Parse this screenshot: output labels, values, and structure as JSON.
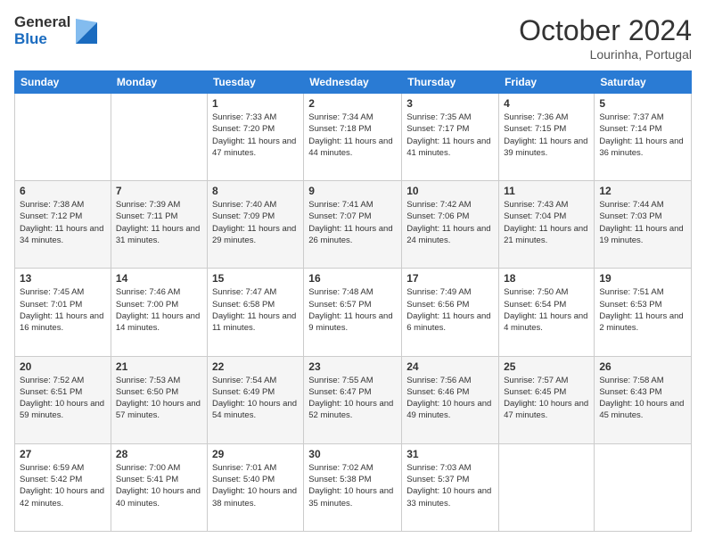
{
  "logo": {
    "general": "General",
    "blue": "Blue"
  },
  "header": {
    "month": "October 2024",
    "location": "Lourinha, Portugal"
  },
  "weekdays": [
    "Sunday",
    "Monday",
    "Tuesday",
    "Wednesday",
    "Thursday",
    "Friday",
    "Saturday"
  ],
  "weeks": [
    [
      {
        "day": "",
        "info": ""
      },
      {
        "day": "",
        "info": ""
      },
      {
        "day": "1",
        "info": "Sunrise: 7:33 AM\nSunset: 7:20 PM\nDaylight: 11 hours and 47 minutes."
      },
      {
        "day": "2",
        "info": "Sunrise: 7:34 AM\nSunset: 7:18 PM\nDaylight: 11 hours and 44 minutes."
      },
      {
        "day": "3",
        "info": "Sunrise: 7:35 AM\nSunset: 7:17 PM\nDaylight: 11 hours and 41 minutes."
      },
      {
        "day": "4",
        "info": "Sunrise: 7:36 AM\nSunset: 7:15 PM\nDaylight: 11 hours and 39 minutes."
      },
      {
        "day": "5",
        "info": "Sunrise: 7:37 AM\nSunset: 7:14 PM\nDaylight: 11 hours and 36 minutes."
      }
    ],
    [
      {
        "day": "6",
        "info": "Sunrise: 7:38 AM\nSunset: 7:12 PM\nDaylight: 11 hours and 34 minutes."
      },
      {
        "day": "7",
        "info": "Sunrise: 7:39 AM\nSunset: 7:11 PM\nDaylight: 11 hours and 31 minutes."
      },
      {
        "day": "8",
        "info": "Sunrise: 7:40 AM\nSunset: 7:09 PM\nDaylight: 11 hours and 29 minutes."
      },
      {
        "day": "9",
        "info": "Sunrise: 7:41 AM\nSunset: 7:07 PM\nDaylight: 11 hours and 26 minutes."
      },
      {
        "day": "10",
        "info": "Sunrise: 7:42 AM\nSunset: 7:06 PM\nDaylight: 11 hours and 24 minutes."
      },
      {
        "day": "11",
        "info": "Sunrise: 7:43 AM\nSunset: 7:04 PM\nDaylight: 11 hours and 21 minutes."
      },
      {
        "day": "12",
        "info": "Sunrise: 7:44 AM\nSunset: 7:03 PM\nDaylight: 11 hours and 19 minutes."
      }
    ],
    [
      {
        "day": "13",
        "info": "Sunrise: 7:45 AM\nSunset: 7:01 PM\nDaylight: 11 hours and 16 minutes."
      },
      {
        "day": "14",
        "info": "Sunrise: 7:46 AM\nSunset: 7:00 PM\nDaylight: 11 hours and 14 minutes."
      },
      {
        "day": "15",
        "info": "Sunrise: 7:47 AM\nSunset: 6:58 PM\nDaylight: 11 hours and 11 minutes."
      },
      {
        "day": "16",
        "info": "Sunrise: 7:48 AM\nSunset: 6:57 PM\nDaylight: 11 hours and 9 minutes."
      },
      {
        "day": "17",
        "info": "Sunrise: 7:49 AM\nSunset: 6:56 PM\nDaylight: 11 hours and 6 minutes."
      },
      {
        "day": "18",
        "info": "Sunrise: 7:50 AM\nSunset: 6:54 PM\nDaylight: 11 hours and 4 minutes."
      },
      {
        "day": "19",
        "info": "Sunrise: 7:51 AM\nSunset: 6:53 PM\nDaylight: 11 hours and 2 minutes."
      }
    ],
    [
      {
        "day": "20",
        "info": "Sunrise: 7:52 AM\nSunset: 6:51 PM\nDaylight: 10 hours and 59 minutes."
      },
      {
        "day": "21",
        "info": "Sunrise: 7:53 AM\nSunset: 6:50 PM\nDaylight: 10 hours and 57 minutes."
      },
      {
        "day": "22",
        "info": "Sunrise: 7:54 AM\nSunset: 6:49 PM\nDaylight: 10 hours and 54 minutes."
      },
      {
        "day": "23",
        "info": "Sunrise: 7:55 AM\nSunset: 6:47 PM\nDaylight: 10 hours and 52 minutes."
      },
      {
        "day": "24",
        "info": "Sunrise: 7:56 AM\nSunset: 6:46 PM\nDaylight: 10 hours and 49 minutes."
      },
      {
        "day": "25",
        "info": "Sunrise: 7:57 AM\nSunset: 6:45 PM\nDaylight: 10 hours and 47 minutes."
      },
      {
        "day": "26",
        "info": "Sunrise: 7:58 AM\nSunset: 6:43 PM\nDaylight: 10 hours and 45 minutes."
      }
    ],
    [
      {
        "day": "27",
        "info": "Sunrise: 6:59 AM\nSunset: 5:42 PM\nDaylight: 10 hours and 42 minutes."
      },
      {
        "day": "28",
        "info": "Sunrise: 7:00 AM\nSunset: 5:41 PM\nDaylight: 10 hours and 40 minutes."
      },
      {
        "day": "29",
        "info": "Sunrise: 7:01 AM\nSunset: 5:40 PM\nDaylight: 10 hours and 38 minutes."
      },
      {
        "day": "30",
        "info": "Sunrise: 7:02 AM\nSunset: 5:38 PM\nDaylight: 10 hours and 35 minutes."
      },
      {
        "day": "31",
        "info": "Sunrise: 7:03 AM\nSunset: 5:37 PM\nDaylight: 10 hours and 33 minutes."
      },
      {
        "day": "",
        "info": ""
      },
      {
        "day": "",
        "info": ""
      }
    ]
  ]
}
